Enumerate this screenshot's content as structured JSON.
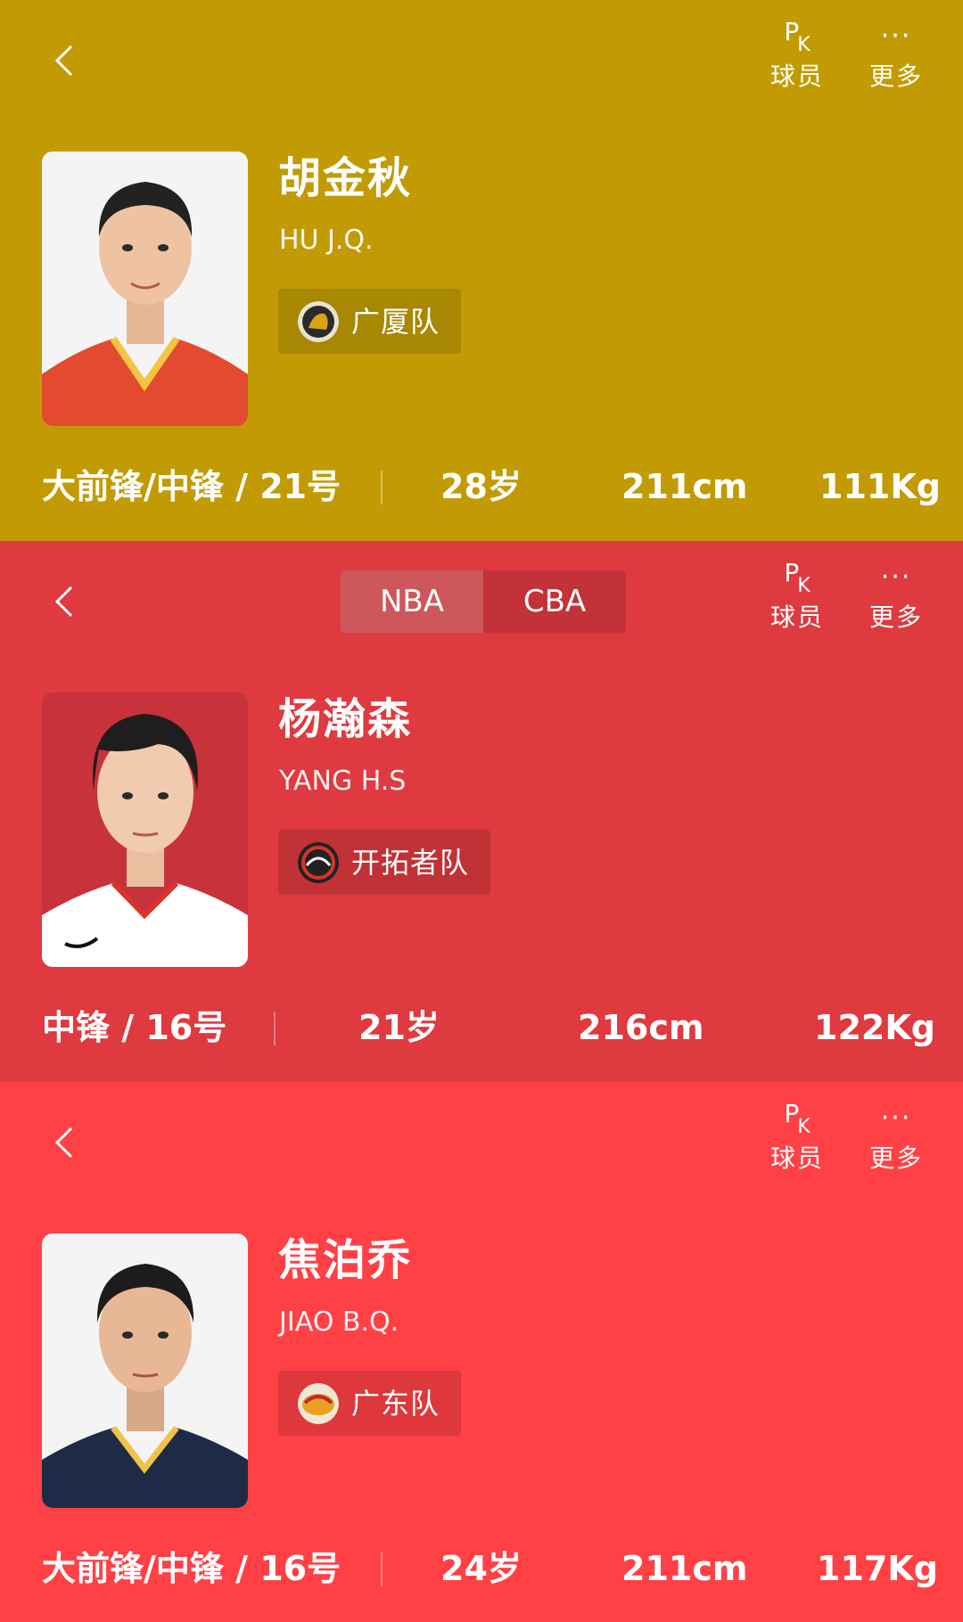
{
  "common": {
    "pk_label": "球员",
    "pk_glyph_p": "P",
    "pk_glyph_k": "K",
    "more_label": "更多",
    "more_glyph": "···"
  },
  "tabs": [
    "NBA",
    "CBA"
  ],
  "players": [
    {
      "name": "胡金秋",
      "en_name": "HU J.Q.",
      "team": "广厦队",
      "position": "大前锋/中锋 / 21号",
      "age": "28岁",
      "height": "211cm",
      "weight": "111Kg",
      "bg": "#c29b04",
      "jersey": "#e34a2f"
    },
    {
      "name": "杨瀚森",
      "en_name": "YANG H.S",
      "team": "开拓者队",
      "position": "中锋 / 16号",
      "age": "21岁",
      "height": "216cm",
      "weight": "122Kg",
      "bg": "#de3a40",
      "jersey": "#ffffff"
    },
    {
      "name": "焦泊乔",
      "en_name": "JIAO B.Q.",
      "team": "广东队",
      "position": "大前锋/中锋 / 16号",
      "age": "24岁",
      "height": "211cm",
      "weight": "117Kg",
      "bg": "#ff4146",
      "jersey": "#1d2b46"
    }
  ]
}
